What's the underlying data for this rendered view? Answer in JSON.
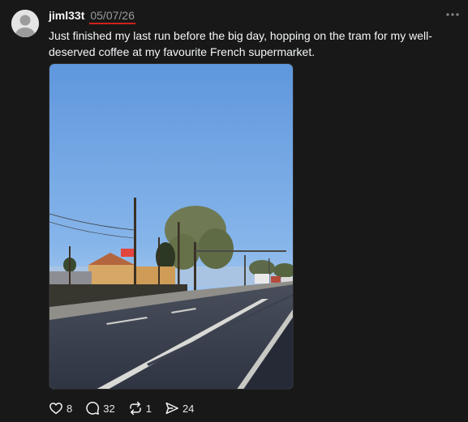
{
  "post": {
    "username": "jiml33t",
    "timestamp": "05/07/26",
    "text": "Just finished my last run before the big day, hopping on the tram for my well-deserved coffee at my favourite French supermarket."
  },
  "actions": {
    "likes": "8",
    "replies": "32",
    "reposts": "1",
    "shares": "24"
  },
  "icons": {
    "more": "more-horizontal-icon",
    "like": "heart-icon",
    "reply": "comment-bubble-icon",
    "repost": "repost-icon",
    "share": "send-icon"
  },
  "colors": {
    "background": "#181818",
    "text": "#f3f5f7",
    "timestamp": "#9a9a9a",
    "underline": "#d0211b"
  }
}
